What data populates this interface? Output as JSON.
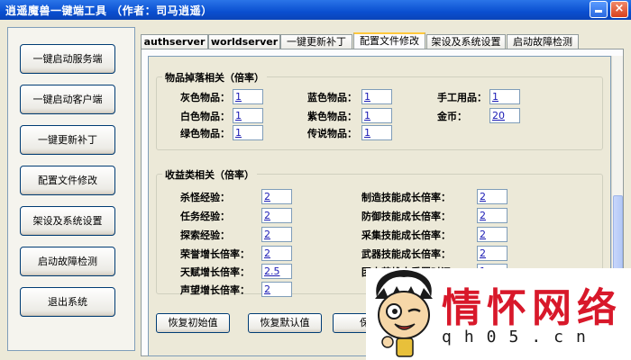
{
  "window": {
    "title": "逍遥魔兽一键端工具 （作者：司马逍遥）",
    "close_glyph": "×"
  },
  "sidebar": {
    "buttons": [
      {
        "label": "一键启动服务端"
      },
      {
        "label": "一键启动客户端"
      },
      {
        "label": "一键更新补丁"
      },
      {
        "label": "配置文件修改"
      },
      {
        "label": "架设及系统设置"
      },
      {
        "label": "启动故障检测"
      },
      {
        "label": "退出系统"
      }
    ]
  },
  "tabs": [
    {
      "label": "authserver"
    },
    {
      "label": "worldserver"
    },
    {
      "label": "一键更新补丁"
    },
    {
      "label": "配置文件修改",
      "active": true
    },
    {
      "label": "架设及系统设置"
    },
    {
      "label": "启动故障检测"
    }
  ],
  "drop_group": {
    "title": "物品掉落相关（倍率）",
    "fields": [
      {
        "label": "灰色物品：",
        "value": "1"
      },
      {
        "label": "蓝色物品：",
        "value": "1"
      },
      {
        "label": "手工用品：",
        "value": "1"
      },
      {
        "label": "白色物品：",
        "value": "1"
      },
      {
        "label": "紫色物品：",
        "value": "1"
      },
      {
        "label": "金币：",
        "value": "20"
      },
      {
        "label": "绿色物品：",
        "value": "1"
      },
      {
        "label": "传说物品：",
        "value": "1"
      }
    ]
  },
  "gain_group": {
    "title": "收益类相关（倍率）",
    "fields": [
      {
        "label": "杀怪经验：",
        "value": "2"
      },
      {
        "label": "制造技能成长倍率：",
        "value": "2"
      },
      {
        "label": "任务经验：",
        "value": "2"
      },
      {
        "label": "防御技能成长倍率：",
        "value": "2"
      },
      {
        "label": "探索经验：",
        "value": "2"
      },
      {
        "label": "采集技能成长倍率：",
        "value": "2"
      },
      {
        "label": "荣誉增长倍率：",
        "value": "2"
      },
      {
        "label": "武器技能成长倍率：",
        "value": "2"
      },
      {
        "label": "天赋增长倍率：",
        "value": "2.5"
      },
      {
        "label": "团本英雄本重置时间：",
        "value": "1"
      },
      {
        "label": "声望增长倍率：",
        "value": "2"
      }
    ]
  },
  "actions": {
    "restore_initial": "恢复初始值",
    "restore_default": "恢复默认值",
    "save": "保存"
  },
  "watermark": {
    "text": "情怀网络",
    "url": "qh05.cn",
    "color": "#d8182a"
  }
}
